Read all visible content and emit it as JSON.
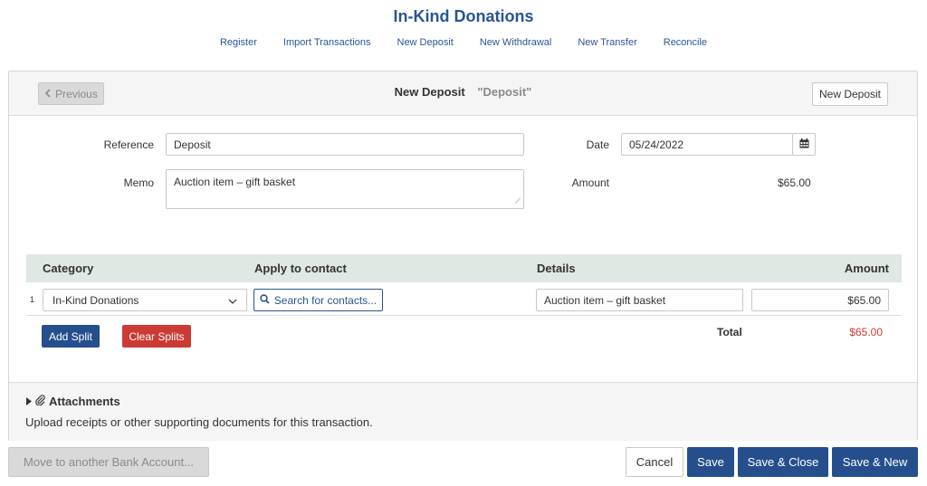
{
  "page": {
    "title": "In-Kind Donations"
  },
  "subnav": [
    "Register",
    "Import Transactions",
    "New Deposit",
    "New Withdrawal",
    "New Transfer",
    "Reconcile"
  ],
  "header": {
    "previous_label": "Previous",
    "title": "New Deposit",
    "subtitle": "\"Deposit\"",
    "new_deposit_label": "New Deposit"
  },
  "form": {
    "reference_label": "Reference",
    "reference_value": "Deposit",
    "memo_label": "Memo",
    "memo_value": "Auction item – gift basket",
    "date_label": "Date",
    "date_value": "05/24/2022",
    "amount_label": "Amount",
    "amount_value": "$65.00"
  },
  "splits": {
    "headers": {
      "category": "Category",
      "contact": "Apply to contact",
      "details": "Details",
      "amount": "Amount"
    },
    "rows": [
      {
        "num": "1",
        "category": "In-Kind Donations",
        "contact_search": "Search for contacts...",
        "details": "Auction item – gift basket",
        "amount": "$65.00"
      }
    ],
    "add_split": "Add Split",
    "clear_splits": "Clear Splits",
    "total_label": "Total",
    "total_value": "$65.00"
  },
  "attachments": {
    "title": "Attachments",
    "description": "Upload receipts or other supporting documents for this transaction."
  },
  "footer": {
    "move_label": "Move to another Bank Account...",
    "cancel": "Cancel",
    "save": "Save",
    "save_close": "Save & Close",
    "save_new": "Save & New"
  },
  "colors": {
    "brand": "#2a5592",
    "primary_button": "#254f8c",
    "danger": "#cc3a34",
    "table_header": "#dfe8e3"
  }
}
